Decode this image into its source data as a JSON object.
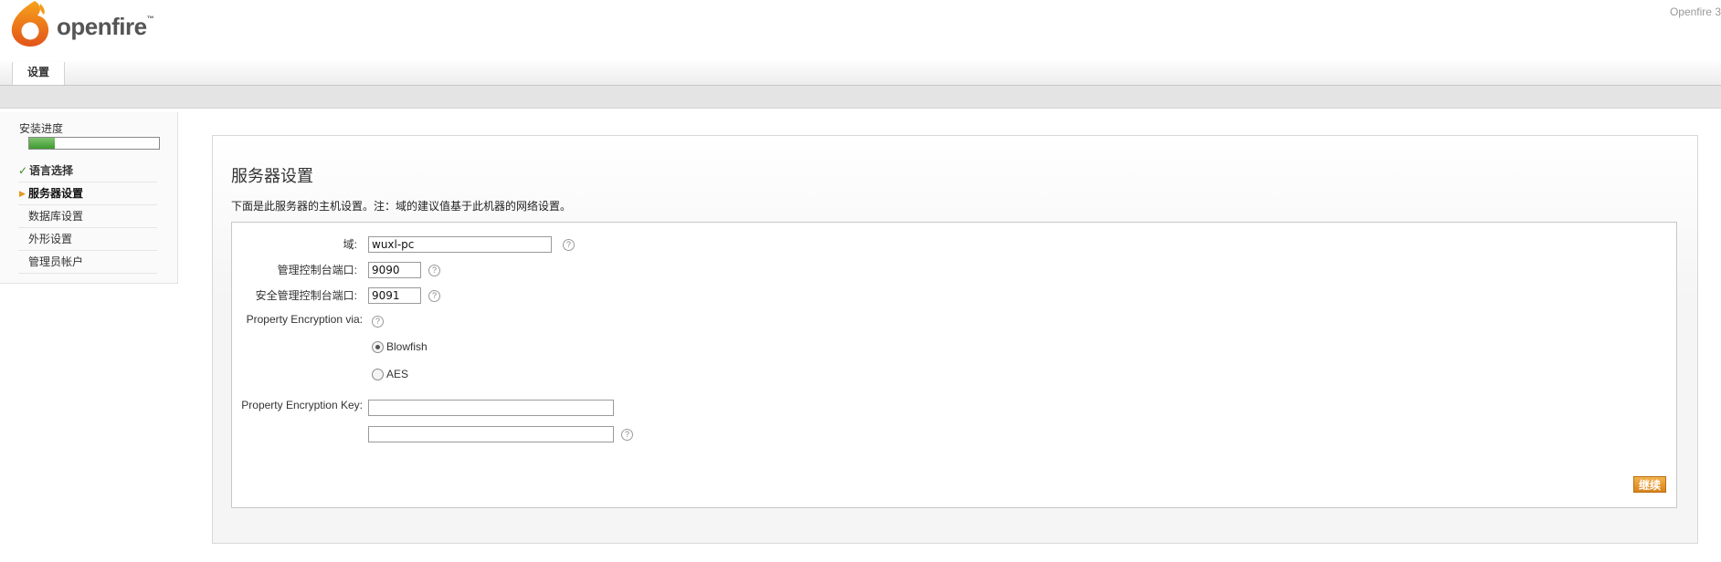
{
  "header": {
    "brand": "openfire",
    "trademark": "™",
    "version_text": "Openfire 3"
  },
  "tabs": [
    {
      "label": "设置"
    }
  ],
  "sidebar": {
    "title": "安装进度",
    "progress": 0.2,
    "steps": [
      {
        "label": "语言选择",
        "state": "done",
        "mark": "✓"
      },
      {
        "label": "服务器设置",
        "state": "current",
        "mark": "▶"
      },
      {
        "label": "数据库设置",
        "state": "pending"
      },
      {
        "label": "外形设置",
        "state": "pending"
      },
      {
        "label": "管理员帐户",
        "state": "pending"
      }
    ]
  },
  "main": {
    "title": "服务器设置",
    "description": "下面是此服务器的主机设置。注：域的建议值基于此机器的网络设置。",
    "fields": {
      "domain": {
        "label": "域:",
        "value": "wuxl-pc"
      },
      "admin_port": {
        "label": "管理控制台端口:",
        "value": "9090"
      },
      "secure_port": {
        "label": "安全管理控制台端口:",
        "value": "9091"
      },
      "encryption_via": {
        "label": "Property Encryption via:"
      },
      "encryption_options": [
        {
          "label": "Blowfish",
          "checked": true
        },
        {
          "label": "AES",
          "checked": false
        }
      ],
      "encryption_key": {
        "label": "Property Encryption Key:",
        "value": "",
        "confirm_value": ""
      }
    },
    "help_symbol": "?",
    "continue_label": "继续"
  },
  "colors": {
    "accent": "#e39a1c",
    "progress": "#4ea83c",
    "done_check": "#3b8a1e",
    "button": "#e08e22"
  }
}
